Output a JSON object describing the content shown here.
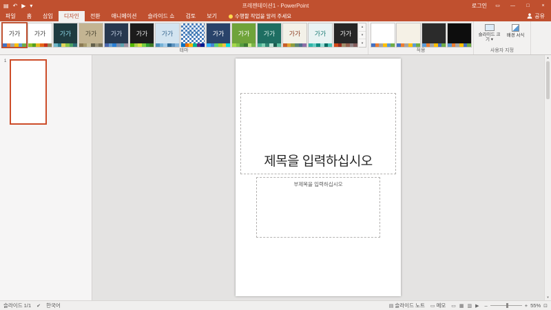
{
  "titlebar": {
    "title": "프레젠테이션1 - PowerPoint",
    "signin": "로그인"
  },
  "ribbon": {
    "tabs": [
      {
        "id": "file",
        "label": "파일"
      },
      {
        "id": "home",
        "label": "홈"
      },
      {
        "id": "insert",
        "label": "삽입"
      },
      {
        "id": "design",
        "label": "디자인",
        "active": true
      },
      {
        "id": "transitions",
        "label": "전환"
      },
      {
        "id": "animations",
        "label": "애니메이션"
      },
      {
        "id": "slideshow",
        "label": "슬라이드 쇼"
      },
      {
        "id": "review",
        "label": "검토"
      },
      {
        "id": "view",
        "label": "보기"
      }
    ],
    "tell_me": "수행할 작업을 알려 주세요",
    "share": "공유",
    "groups": {
      "themes": "테마",
      "variants": "적용",
      "customize": "사용자 지정"
    },
    "theme_label": "가가",
    "themes": [
      {
        "bg": "#ffffff",
        "fg": "#404040",
        "selected": true,
        "strip": [
          "#4472c4",
          "#ed7d31",
          "#a5a5a5",
          "#ffc000",
          "#5b9bd5",
          "#70ad47"
        ]
      },
      {
        "bg": "#ffffff",
        "fg": "#404040",
        "strip": [
          "#90c226",
          "#54a021",
          "#e6b91e",
          "#e76618",
          "#c42f1a",
          "#918655"
        ]
      },
      {
        "bg": "#1f3b40",
        "fg": "#8ed8e8",
        "strip": [
          "#6fb7c8",
          "#2d8393",
          "#e2d45a",
          "#88c446",
          "#4aa366",
          "#2f6d78"
        ]
      },
      {
        "bg": "#c3b492",
        "fg": "#46402e",
        "strip": [
          "#8c7b54",
          "#a79a6c",
          "#c4bc96",
          "#63604b",
          "#9c9377",
          "#7a7458"
        ]
      },
      {
        "bg": "#27384f",
        "fg": "#c7d3e5",
        "strip": [
          "#4a66ac",
          "#629dd1",
          "#297fd5",
          "#7f8fa9",
          "#5aa2ae",
          "#9d90a0"
        ]
      },
      {
        "bg": "#1c1c1c",
        "fg": "#e8e8e8",
        "strip": [
          "#52ba00",
          "#a8cc4c",
          "#d6e040",
          "#77cf3e",
          "#2f9e33",
          "#3f7c24"
        ]
      },
      {
        "bg": "#d3e4f0",
        "fg": "#38678f",
        "strip": [
          "#4e8fbb",
          "#76b3d8",
          "#a3cbe8",
          "#2f6c99",
          "#5e94c0",
          "#89b8dd"
        ]
      },
      {
        "bg": "#ffffff",
        "fg": "#2e70a8",
        "pattern": "checker",
        "strip": [
          "#0072c6",
          "#ef6c00",
          "#ffb900",
          "#00b294",
          "#68217a",
          "#00188f"
        ]
      },
      {
        "bg": "#29436a",
        "fg": "#ffffff",
        "strip": [
          "#31b6fd",
          "#4584d3",
          "#5bd078",
          "#a5d028",
          "#f5c040",
          "#05e0db"
        ]
      },
      {
        "bg": "#6fa33a",
        "fg": "#ffffff",
        "strip": [
          "#a5d848",
          "#81c346",
          "#559d3f",
          "#3e7a32",
          "#c2e680",
          "#7ab648"
        ]
      },
      {
        "bg": "#1e6e62",
        "fg": "#d8f0e8",
        "strip": [
          "#49b294",
          "#7ed0b2",
          "#2e8573",
          "#bce4d6",
          "#1d5c50",
          "#5bbfa0"
        ]
      },
      {
        "bg": "#f3f1e8",
        "fg": "#8a3b1e",
        "strip": [
          "#c95f2b",
          "#e0a32f",
          "#8f9f3e",
          "#5b8772",
          "#4f6e8f",
          "#8e6fa8"
        ]
      },
      {
        "bg": "#e9f3f3",
        "fg": "#1a7a74",
        "strip": [
          "#31b7aa",
          "#66cdc4",
          "#0f8a80",
          "#94ddd6",
          "#0b6b63",
          "#45c2b6"
        ]
      },
      {
        "bg": "#262626",
        "fg": "#f2f2f2",
        "strip": [
          "#d34817",
          "#9b2d1f",
          "#a28e6a",
          "#956251",
          "#918485",
          "#855d5d"
        ]
      }
    ],
    "variants": [
      {
        "bg": "#ffffff",
        "strip": [
          "#4472c4",
          "#ed7d31",
          "#a5a5a5",
          "#ffc000",
          "#5b9bd5",
          "#70ad47"
        ]
      },
      {
        "bg": "#f5f1e6",
        "strip": [
          "#4472c4",
          "#ed7d31",
          "#a5a5a5",
          "#ffc000",
          "#5b9bd5",
          "#70ad47"
        ]
      },
      {
        "bg": "#2b2b2b",
        "strip": [
          "#5b9bd5",
          "#ed7d31",
          "#a5a5a5",
          "#ffc000",
          "#4472c4",
          "#70ad47"
        ]
      },
      {
        "bg": "#0d0d0d",
        "strip": [
          "#5b9bd5",
          "#ed7d31",
          "#a5a5a5",
          "#ffc000",
          "#4472c4",
          "#70ad47"
        ]
      }
    ],
    "customize_buttons": [
      {
        "name": "slide-size-button",
        "icon": "slide-size-icon",
        "label": "슬라이드 크기",
        "arrow": "▾"
      },
      {
        "name": "format-background-button",
        "icon": "format-background-icon",
        "label": "배경 서식",
        "arrow": ""
      }
    ]
  },
  "slide_panel": {
    "slide_number": "1"
  },
  "slide": {
    "title_placeholder": "제목을 입력하십시오",
    "subtitle_placeholder": "부제목을 입력하십시오"
  },
  "statusbar": {
    "slide_indicator": "슬라이드 1/1",
    "language": "한국어",
    "notes": "슬라이드 노트",
    "comments": "메모",
    "zoom_percent": "55%"
  }
}
